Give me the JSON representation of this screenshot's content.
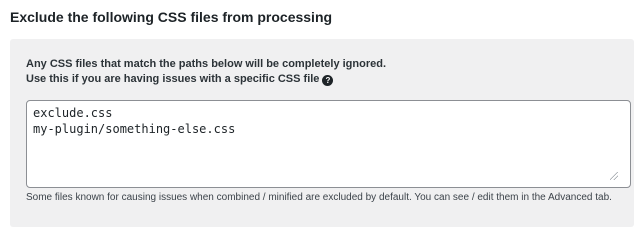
{
  "section": {
    "title": "Exclude the following CSS files from processing"
  },
  "panel": {
    "intro_line1": "Any CSS files that match the paths below will be completely ignored.",
    "intro_line2": "Use this if you are having issues with a specific CSS file",
    "help_icon": "question-circle-icon",
    "help_glyph": "?",
    "textarea_value": "exclude.css\nmy-plugin/something-else.css",
    "footnote": "Some files known for causing issues when combined / minified are excluded by default. You can see / edit them in the Advanced tab."
  }
}
